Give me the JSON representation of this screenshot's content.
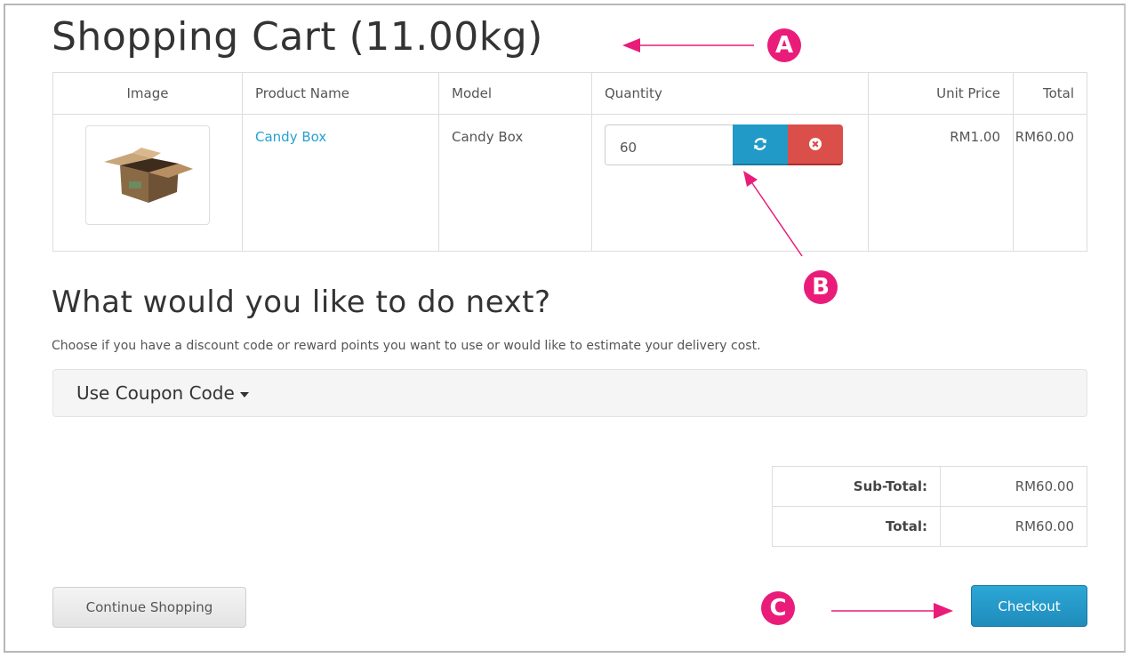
{
  "page_title": "Shopping Cart  (11.00kg)",
  "table": {
    "headers": [
      "Image",
      "Product Name",
      "Model",
      "Quantity",
      "Unit Price",
      "Total"
    ],
    "rows": [
      {
        "product_name": "Candy Box",
        "model": "Candy Box",
        "quantity": "60",
        "unit_price": "RM1.00",
        "total": "RM60.00"
      }
    ]
  },
  "next": {
    "title": "What would you like to do next?",
    "description": "Choose if you have a discount code or reward points you want to use or would like to estimate your delivery cost."
  },
  "coupon_panel": {
    "title": "Use Coupon Code"
  },
  "totals": [
    {
      "label": "Sub-Total:",
      "value": "RM60.00"
    },
    {
      "label": "Total:",
      "value": "RM60.00"
    }
  ],
  "buttons": {
    "continue": "Continue Shopping",
    "checkout": "Checkout"
  },
  "annotations": {
    "a": "A",
    "b": "B",
    "c": "C"
  },
  "colors": {
    "link": "#23a1d1",
    "update_button": "#229ac8",
    "remove_button": "#da4f49",
    "checkout_button": "#229ac8",
    "annotation": "#ea1c7a"
  },
  "icons": {
    "update": "refresh-icon",
    "remove": "remove-circle-icon",
    "panel_caret": "caret-down-icon"
  }
}
